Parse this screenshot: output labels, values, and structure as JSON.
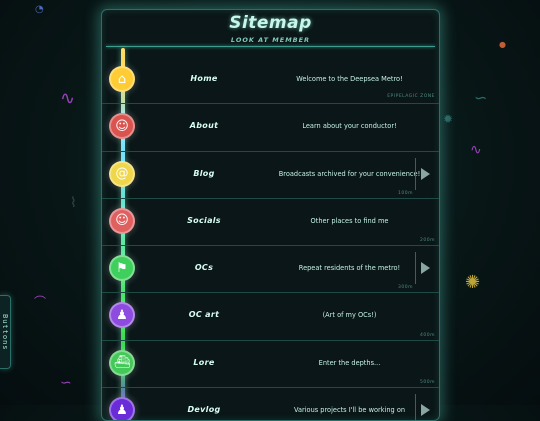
{
  "sitemap": {
    "title": "Sitemap",
    "subtitle": "LOOK AT MEMBER"
  },
  "buttons_tab": {
    "label": "Buttons"
  },
  "rows": [
    {
      "label": "Home",
      "desc": "Welcome to the Deepsea Metro!",
      "depth": "",
      "has_arrow": false,
      "node_color": "#ffcc33",
      "node_icon": "home-icon"
    },
    {
      "label": "About",
      "desc": "Learn about your conductor!",
      "depth": "EPIPELAGIC ZONE",
      "has_arrow": false,
      "node_color": "#d9534f",
      "node_icon": "avatar-icon"
    },
    {
      "label": "Blog",
      "desc": "Broadcasts archived for your convenience!",
      "depth": "100m",
      "has_arrow": true,
      "node_color": "#f0d64a",
      "node_icon": "snail-icon"
    },
    {
      "label": "Socials",
      "desc": "Other places to find me",
      "depth": "200m",
      "has_arrow": false,
      "node_color": "#e06060",
      "node_icon": "avatar-icon"
    },
    {
      "label": "OCs",
      "desc": "Repeat residents of the metro!",
      "depth": "300m",
      "has_arrow": true,
      "node_color": "#3fcf5c",
      "node_icon": "flag-icon"
    },
    {
      "label": "OC art",
      "desc": "(Art of my OCs!)",
      "depth": "400m",
      "has_arrow": false,
      "node_color": "#8d4be0",
      "node_icon": "character-icon"
    },
    {
      "label": "Lore",
      "desc": "Enter the depths...",
      "depth": "500m",
      "has_arrow": false,
      "node_color": "#45c85a",
      "node_icon": "ship-icon"
    },
    {
      "label": "Devlog",
      "desc": "Various projects I'll be working on",
      "depth": "",
      "has_arrow": true,
      "node_color": "#6a2bd9",
      "node_icon": "character-icon"
    }
  ]
}
